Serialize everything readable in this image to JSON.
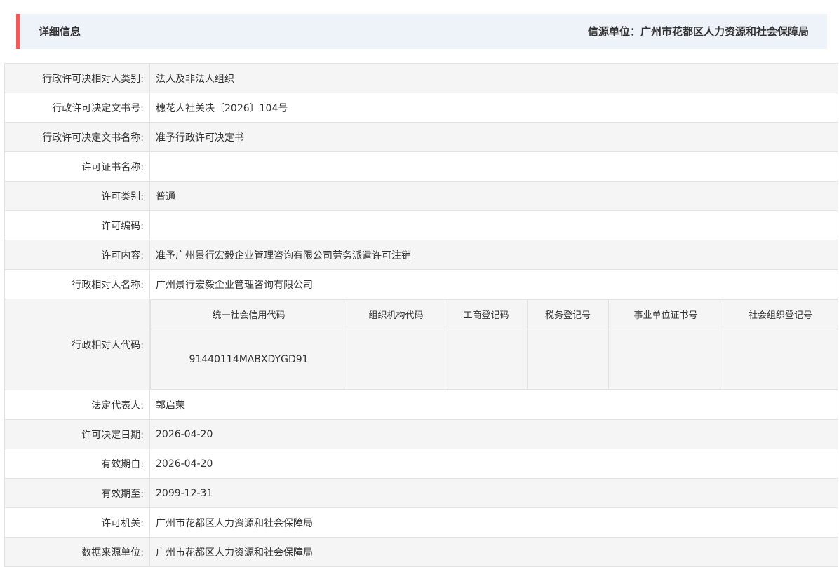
{
  "header": {
    "title": "详细信息",
    "source": "信源单位：广州市花都区人力资源和社会保障局"
  },
  "rows_top": [
    {
      "label": "行政许可决相对人类别:",
      "value": "法人及非法人组织"
    },
    {
      "label": "行政许可决定文书号:",
      "value": "穗花人社关决〔2026〕104号"
    },
    {
      "label": "行政许可决定文书名称:",
      "value": "准予行政许可决定书"
    },
    {
      "label": "许可证书名称:",
      "value": ""
    },
    {
      "label": "许可类别:",
      "value": "普通"
    },
    {
      "label": "许可编码:",
      "value": ""
    },
    {
      "label": "许可内容:",
      "value": "准予广州景行宏毅企业管理咨询有限公司劳务派遣许可注销"
    },
    {
      "label": "行政相对人名称:",
      "value": "广州景行宏毅企业管理咨询有限公司"
    }
  ],
  "code_row": {
    "label": "行政相对人代码:",
    "headers": [
      "统一社会信用代码",
      "组织机构代码",
      "工商登记码",
      "税务登记号",
      "事业单位证书号",
      "社会组织登记号"
    ],
    "values": [
      "91440114MABXDYGD91",
      "",
      "",
      "",
      "",
      ""
    ]
  },
  "rows_bottom": [
    {
      "label": "法定代表人:",
      "value": "郭启荣"
    },
    {
      "label": "许可决定日期:",
      "value": "2026-04-20"
    },
    {
      "label": "有效期自:",
      "value": "2026-04-20"
    },
    {
      "label": "有效期至:",
      "value": "2099-12-31"
    },
    {
      "label": "许可机关:",
      "value": "广州市花都区人力资源和社会保障局"
    },
    {
      "label": "数据来源单位:",
      "value": "广州市花都区人力资源和社会保障局"
    }
  ]
}
